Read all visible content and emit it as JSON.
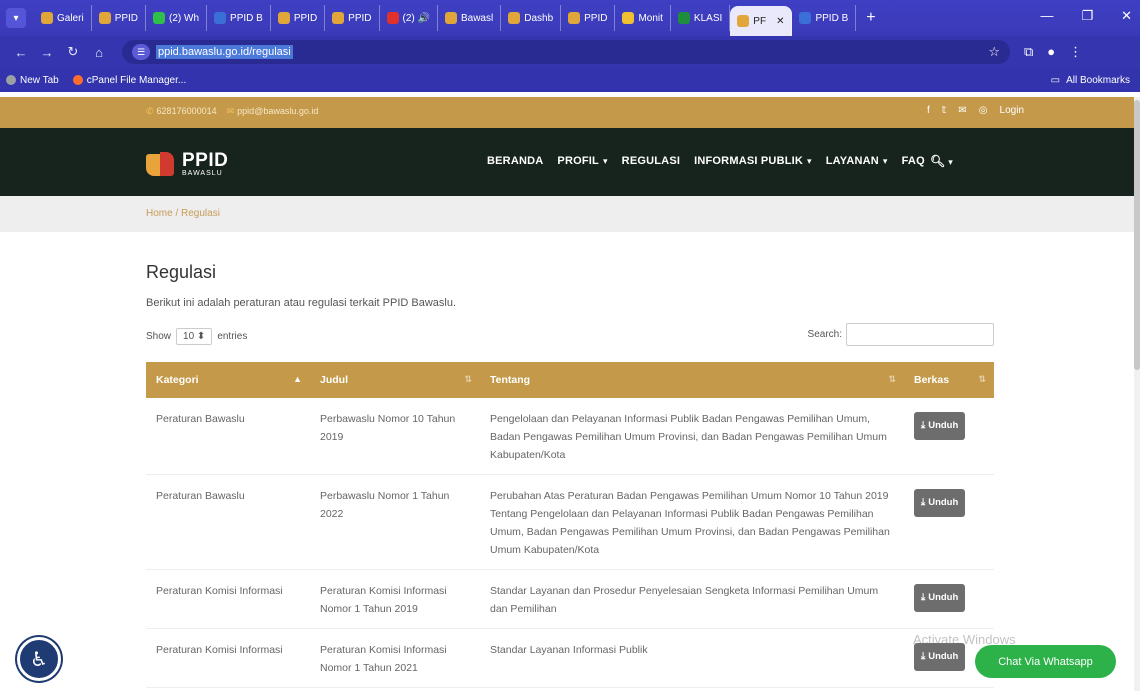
{
  "browser": {
    "tabs": [
      {
        "label": "Galeri",
        "color": "#e0a63a"
      },
      {
        "label": "PPID",
        "color": "#e0a63a"
      },
      {
        "label": "(2) Wh",
        "color": "#2fbf4a"
      },
      {
        "label": "PPID B",
        "color": "#3a6fd8"
      },
      {
        "label": "PPID",
        "color": "#e0a63a"
      },
      {
        "label": "PPID",
        "color": "#e0a63a"
      },
      {
        "label": "(2) 🔊",
        "color": "#e0312b"
      },
      {
        "label": "Bawasl",
        "color": "#e0a63a"
      },
      {
        "label": "Dashb",
        "color": "#e0a63a"
      },
      {
        "label": "PPID",
        "color": "#e0a63a"
      },
      {
        "label": "Monit",
        "color": "#f1c030"
      },
      {
        "label": "KLASI",
        "color": "#1e8e3e"
      },
      {
        "label": "PF",
        "color": "#e0a63a",
        "active": true
      },
      {
        "label": "PPID B",
        "color": "#3a6fd8"
      }
    ],
    "url": "ppid.bawaslu.go.id/regulasi",
    "bookmarks": [
      {
        "label": "New Tab",
        "color": "#9aa0a6"
      },
      {
        "label": "cPanel File Manager...",
        "color": "#ff6c2c"
      }
    ],
    "all_bookmarks": "All Bookmarks"
  },
  "site": {
    "phone": "628176000014",
    "email": "ppid@bawaslu.go.id",
    "login": "Login",
    "logo_text": "PPID",
    "logo_sub": "BAWASLU",
    "menu": [
      {
        "label": "BERANDA",
        "caret": false
      },
      {
        "label": "PROFIL",
        "caret": true
      },
      {
        "label": "REGULASI",
        "caret": false
      },
      {
        "label": "INFORMASI PUBLIK",
        "caret": true
      },
      {
        "label": "LAYANAN",
        "caret": true
      },
      {
        "label": "FAQ",
        "caret": false
      }
    ],
    "breadcrumb": "Home  /  Regulasi"
  },
  "main": {
    "title": "Regulasi",
    "description": "Berikut ini adalah peraturan atau regulasi terkait PPID Bawaslu.",
    "show_label": "Show",
    "show_value": "10",
    "entries_label": "entries",
    "search_label": "Search:",
    "search_value": "",
    "download_label": "Unduh",
    "table": {
      "headers": [
        "Kategori",
        "Judul",
        "Tentang",
        "Berkas"
      ],
      "rows": [
        {
          "kategori": "Peraturan Bawaslu",
          "judul": "Perbawaslu Nomor 10 Tahun 2019",
          "tentang": "Pengelolaan dan Pelayanan Informasi Publik Badan Pengawas Pemilihan Umum, Badan Pengawas Pemilihan Umum Provinsi, dan Badan Pengawas Pemilihan Umum Kabupaten/Kota"
        },
        {
          "kategori": "Peraturan Bawaslu",
          "judul": "Perbawaslu Nomor 1 Tahun 2022",
          "tentang": "Perubahan Atas Peraturan Badan Pengawas Pemilihan Umum Nomor 10 Tahun 2019 Tentang Pengelolaan dan Pelayanan Informasi Publik Badan Pengawas Pemilihan Umum, Badan Pengawas Pemilihan Umum Provinsi, dan Badan Pengawas Pemilihan Umum Kabupaten/Kota"
        },
        {
          "kategori": "Peraturan Komisi Informasi",
          "judul": "Peraturan Komisi Informasi Nomor 1 Tahun 2019",
          "tentang": "Standar Layanan dan Prosedur Penyelesaian Sengketa Informasi Pemilihan Umum dan Pemilihan"
        },
        {
          "kategori": "Peraturan Komisi Informasi",
          "judul": "Peraturan Komisi Informasi Nomor 1 Tahun 2021",
          "tentang": "Standar Layanan Informasi Publik"
        }
      ]
    }
  },
  "overlay": {
    "watermark": "Activate Windows",
    "whatsapp": "Chat Via Whatsapp"
  }
}
